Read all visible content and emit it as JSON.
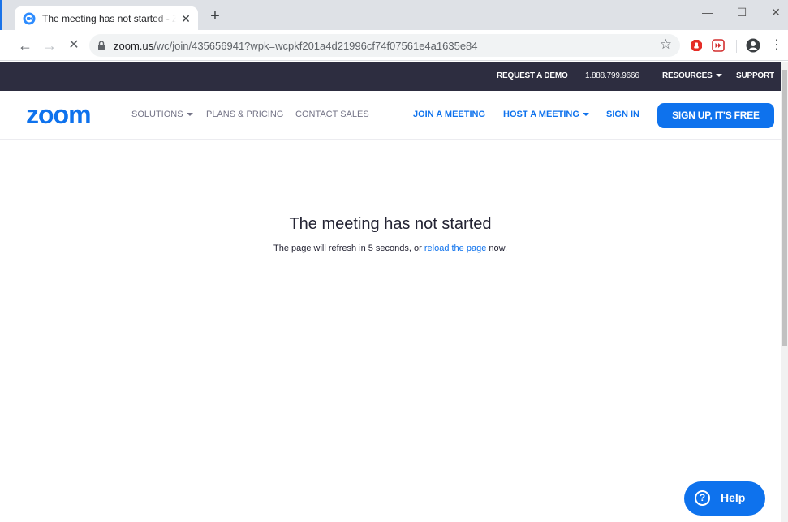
{
  "browser": {
    "tab": {
      "title": "The meeting has not started - Zoom",
      "close": "✕"
    },
    "new_tab": "+",
    "window_controls": {
      "minimize": "—",
      "maximize": "☐",
      "close": "✕"
    },
    "nav": {
      "back": "←",
      "forward": "→",
      "stop": "✕"
    },
    "url": {
      "host": "zoom.us",
      "path": "/wc/join/435656941?wpk=wcpkf201a4d21996cf74f07561e4a1635e84"
    },
    "star": "☆",
    "menu": "⋮"
  },
  "topbar": {
    "request_demo": "REQUEST A DEMO",
    "phone": "1.888.799.9666",
    "resources": "RESOURCES",
    "support": "SUPPORT"
  },
  "mainnav": {
    "logo_text": "zoom",
    "solutions": "SOLUTIONS",
    "plans": "PLANS & PRICING",
    "contact": "CONTACT SALES",
    "join": "JOIN A MEETING",
    "host": "HOST A MEETING",
    "signin": "SIGN IN",
    "signup": "SIGN UP, IT'S FREE"
  },
  "message": {
    "heading": "The meeting has not started",
    "text_before": "The page will refresh in 5 seconds, or ",
    "link": "reload the page",
    "text_after": " now."
  },
  "help": {
    "icon": "?",
    "label": "Help"
  },
  "colors": {
    "brand_blue": "#0e72ed",
    "topbar_bg": "#2d2d40"
  }
}
